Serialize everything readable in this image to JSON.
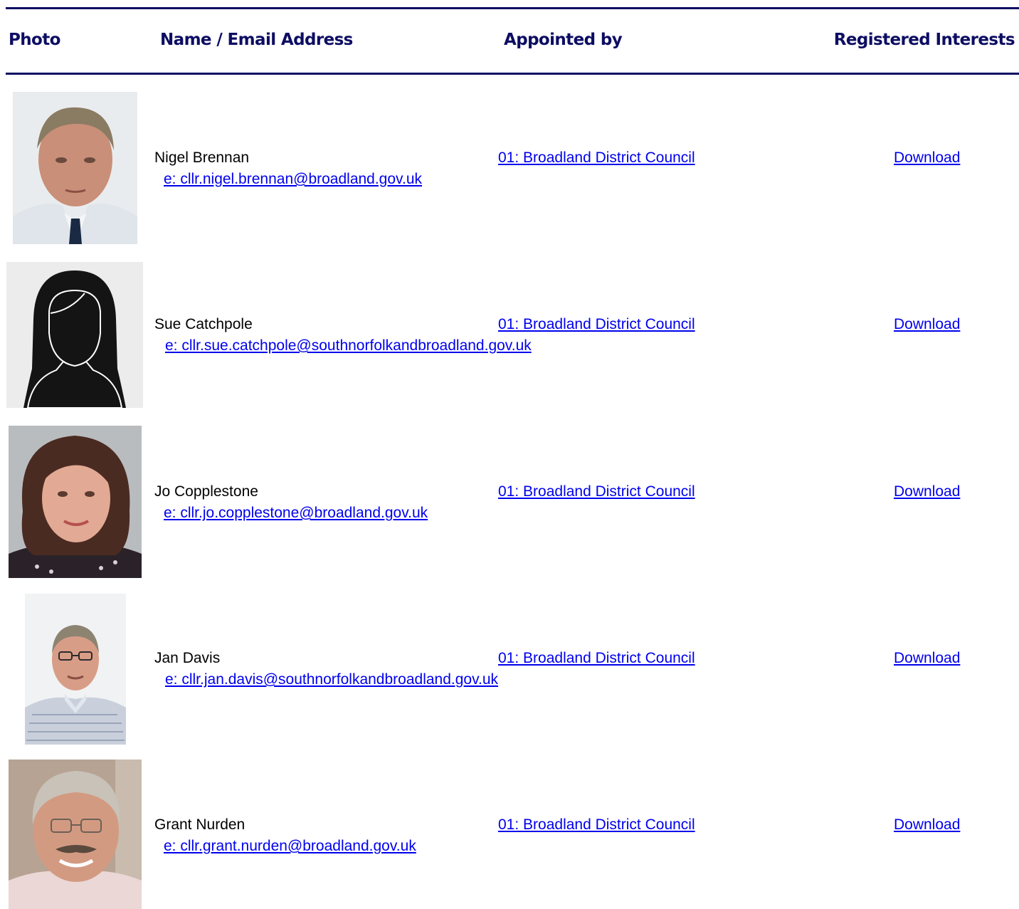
{
  "table": {
    "headers": {
      "photo": "Photo",
      "name": "Name / Email Address",
      "appointed": "Appointed by",
      "interests": "Registered Interests"
    },
    "rows": [
      {
        "name": "Nigel Brennan",
        "email": " e: cllr.nigel.brennan@broadland.gov.uk",
        "appointed_by": "01: Broadland District Council",
        "interests_link": "Download",
        "photo_kind": "man-grey-hair-suit"
      },
      {
        "name": "Sue Catchpole",
        "email": " e: cllr.sue.catchpole@southnorfolkandbroadland.gov.uk",
        "appointed_by": "01: Broadland District Council",
        "interests_link": "Download",
        "photo_kind": "female-silhouette-placeholder"
      },
      {
        "name": "Jo Copplestone",
        "email": " e: cllr.jo.copplestone@broadland.gov.uk",
        "appointed_by": "01: Broadland District Council",
        "interests_link": "Download",
        "photo_kind": "woman-dark-hair"
      },
      {
        "name": "Jan Davis",
        "email": " e: cllr.jan.davis@southnorfolkandbroadland.gov.uk",
        "appointed_by": "01: Broadland District Council",
        "interests_link": "Download",
        "photo_kind": "man-glasses-striped-shirt"
      },
      {
        "name": "Grant Nurden",
        "email": " e: cllr.grant.nurden@broadland.gov.uk",
        "appointed_by": "01: Broadland District Council",
        "interests_link": "Download",
        "photo_kind": "man-moustache-glasses"
      }
    ]
  },
  "colors": {
    "header_text": "#0d0d63",
    "rule": "#0d0d63",
    "link": "#0000ee"
  }
}
